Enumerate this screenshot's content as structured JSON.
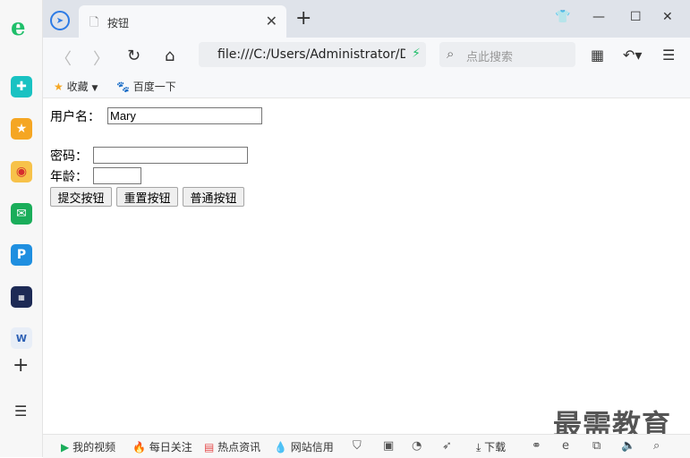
{
  "browser": {
    "tab_title": "按钮",
    "address": "file:///C:/Users/Administrator/Desktop",
    "search_placeholder": "点此搜索",
    "bookmarks": [
      {
        "label": "收藏"
      },
      {
        "label": "百度一下"
      }
    ]
  },
  "form": {
    "username_label": "用户名：",
    "username_value": "Mary",
    "password_label": "密码：",
    "password_value": "",
    "age_label": "年龄：",
    "age_value": "",
    "submit_label": "提交按钮",
    "reset_label": "重置按钮",
    "normal_label": "普通按钮"
  },
  "statusbar": {
    "items": [
      "我的视频",
      "每日关注",
      "热点资讯",
      "网站信用",
      "下载"
    ]
  },
  "watermark": "最需教育",
  "colors": {
    "accent": "#1fbf6a",
    "tab_strip": "#dfe3ea",
    "toolbar": "#f7f8fa"
  }
}
